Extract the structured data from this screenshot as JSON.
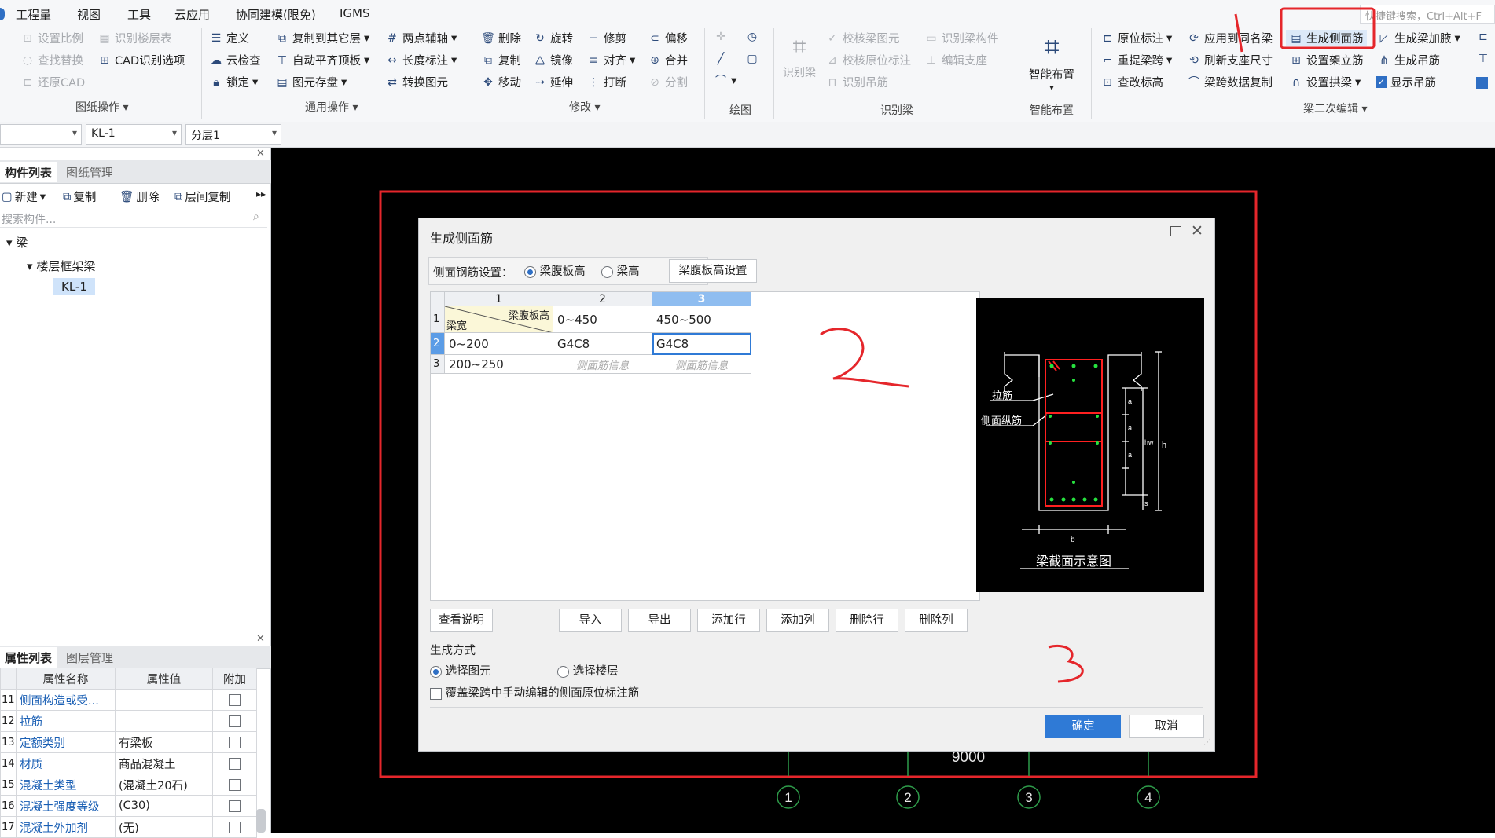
{
  "menu": [
    "工程量",
    "视图",
    "工具",
    "云应用",
    "协同建模(限免)",
    "IGMS"
  ],
  "search_hint": "快捷键搜索，Ctrl+Alt+F",
  "ribbon": {
    "g1": {
      "items": [
        "设置比例",
        "识别楼层表",
        "查找替换",
        "CAD识别选项",
        "还原CAD"
      ],
      "label": "图纸操作"
    },
    "g2": {
      "items": [
        "定义",
        "复制到其它层",
        "两点辅轴",
        "云检查",
        "自动平齐顶板",
        "长度标注",
        "锁定",
        "图元存盘",
        "转换图元"
      ],
      "label": "通用操作"
    },
    "g3": {
      "items": [
        "删除",
        "旋转",
        "修剪",
        "偏移",
        "复制",
        "镜像",
        "对齐",
        "合并",
        "移动",
        "延伸",
        "打断",
        "分割"
      ],
      "label": "修改"
    },
    "g4": {
      "label": "绘图"
    },
    "g5": {
      "items": [
        "识别梁",
        "校核梁图元",
        "识别梁构件",
        "校核原位标注",
        "编辑支座",
        "识别吊筋"
      ],
      "label": "识别梁"
    },
    "g6": {
      "items": [
        "智能布置"
      ],
      "label": "智能布置"
    },
    "g7": {
      "items": [
        "原位标注",
        "应用到同名梁",
        "生成侧面筋",
        "生成梁加腋",
        "重提梁跨",
        "刷新支座尺寸",
        "设置架立筋",
        "生成吊筋",
        "查改标高",
        "梁跨数据复制",
        "设置拱梁",
        "显示吊筋"
      ],
      "label": "梁二次编辑"
    }
  },
  "combos": [
    "",
    "KL-1",
    "分层1"
  ],
  "left_panel": {
    "tabs": [
      "构件列表",
      "图纸管理"
    ],
    "tools": [
      "新建",
      "复制",
      "删除",
      "层间复制"
    ],
    "search_placeholder": "搜索构件...",
    "tree": [
      "梁",
      "楼层框架梁",
      "KL-1"
    ]
  },
  "prop_panel": {
    "tabs": [
      "属性列表",
      "图层管理"
    ],
    "headers": [
      "属性名称",
      "属性值",
      "附加"
    ],
    "rows": [
      {
        "n": "11",
        "name": "侧面构造或受...",
        "value": ""
      },
      {
        "n": "12",
        "name": "拉筋",
        "value": ""
      },
      {
        "n": "13",
        "name": "定额类别",
        "value": "有梁板"
      },
      {
        "n": "14",
        "name": "材质",
        "value": "商品混凝土"
      },
      {
        "n": "15",
        "name": "混凝土类型",
        "value": "(混凝土20石)"
      },
      {
        "n": "16",
        "name": "混凝土强度等级",
        "value": "(C30)"
      },
      {
        "n": "17",
        "name": "混凝土外加剂",
        "value": "(无)"
      }
    ]
  },
  "dialog": {
    "title": "生成侧面筋",
    "setting_label": "侧面钢筋设置：",
    "radio_web": "梁腹板高",
    "radio_beam": "梁高",
    "web_btn": "梁腹板高设置",
    "col_headers": [
      "1",
      "2",
      "3"
    ],
    "diag_top": "梁腹板高",
    "diag_bottom": "梁宽",
    "rows": [
      {
        "n": "1",
        "c1": "",
        "c2": "0~450",
        "c3": "450~500"
      },
      {
        "n": "2",
        "c1": "0~200",
        "c2": "G4C8",
        "c3": "G4C8"
      },
      {
        "n": "3",
        "c1": "200~250",
        "c2": "侧面筋信息",
        "c3": "侧面筋信息"
      }
    ],
    "buttons": [
      "查看说明",
      "导入",
      "导出",
      "添加行",
      "添加列",
      "删除行",
      "删除列"
    ],
    "gen_title": "生成方式",
    "gen_opt1": "选择图元",
    "gen_opt2": "选择楼层",
    "override": "覆盖梁跨中手动编辑的侧面原位标注筋",
    "ok": "确定",
    "cancel": "取消",
    "diagram": {
      "lbl_tie": "拉筋",
      "lbl_side": "侧面纵筋",
      "caption": "梁截面示意图",
      "a": "a",
      "hw": "hw",
      "h": "h",
      "s": "s",
      "b": "b"
    }
  },
  "cad": {
    "dim": "9000",
    "axes": [
      "1",
      "2",
      "3",
      "4"
    ]
  },
  "annotations": [
    "1",
    "2",
    "3"
  ],
  "colors": {
    "accent": "#2f7ad6",
    "highlight": "#e5262b",
    "grid_sel": "#8fbdf0"
  }
}
